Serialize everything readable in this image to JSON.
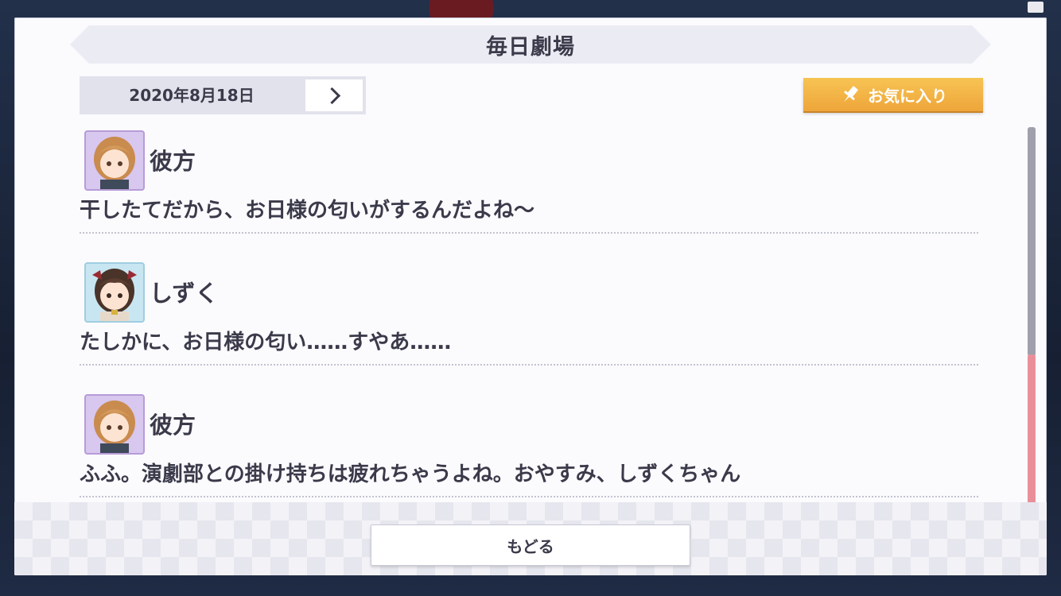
{
  "header": {
    "title": "毎日劇場"
  },
  "date_nav": {
    "date": "2020年8月18日"
  },
  "favorite": {
    "label": "お気に入り"
  },
  "entries": [
    {
      "name": "彼方",
      "line": "干したてだから、お日様の匂いがするんだよね〜",
      "avatar": "kanata-avatar"
    },
    {
      "name": "しずく",
      "line": "たしかに、お日様の匂い……すやあ……",
      "avatar": "shizuku-avatar"
    },
    {
      "name": "彼方",
      "line": "ふふ。演劇部との掛け持ちは疲れちゃうよね。おやすみ、しずくちゃん",
      "avatar": "kanata-avatar"
    }
  ],
  "footer": {
    "back_label": "もどる"
  },
  "colors": {
    "accent": "#eea53a",
    "scroll_thumb": "#e98f9a",
    "text": "#3a3a4a"
  }
}
